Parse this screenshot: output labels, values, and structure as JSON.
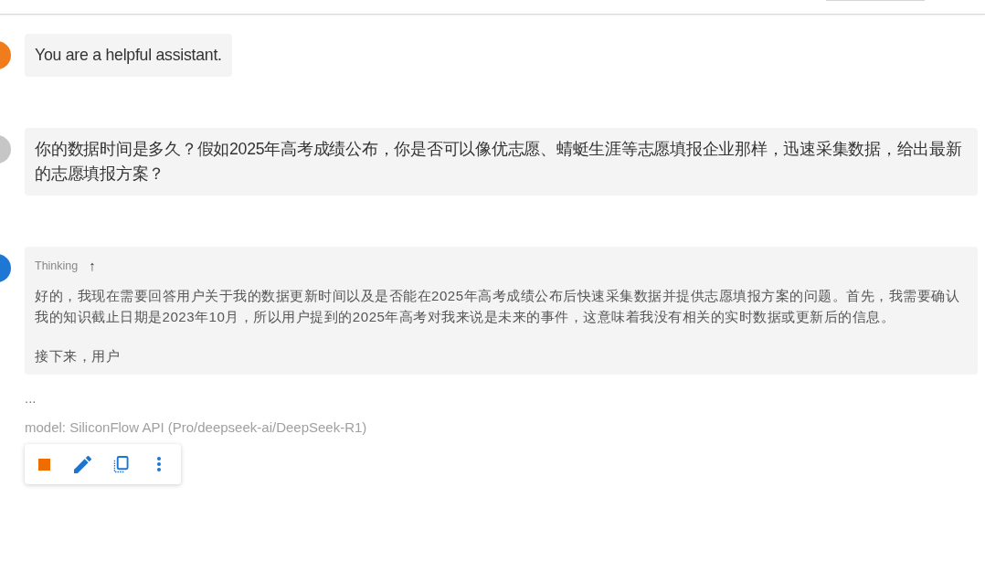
{
  "messages": [
    {
      "color": "#f07c1c",
      "text": "You are a helpful assistant."
    },
    {
      "color": "#c6c6c6",
      "text": "你的数据时间是多久？假如2025年高考成绩公布，你是否可以像优志愿、蜻蜓生涯等志愿填报企业那样，迅速采集数据，给出最新的志愿填报方案？"
    },
    {
      "color": "#1e77d3",
      "thinking": {
        "label": "Thinking",
        "toggle": "↑",
        "paragraphs": [
          "好的，我现在需要回答用户关于我的数据更新时间以及是否能在2025年高考成绩公布后快速采集数据并提供志愿填报方案的问题。首先，我需要确认我的知识截止日期是2023年10月，所以用户提到的2025年高考对我来说是未来的事件，这意味着我没有相关的实时数据或更新后的信息。",
          "接下来，用户"
        ]
      },
      "ellipsis": "...",
      "model": "model: SiliconFlow API (Pro/deepseek-ai/DeepSeek-R1)",
      "actions": [
        {
          "kind": "stop"
        },
        {
          "kind": "edit"
        },
        {
          "kind": "copy"
        },
        {
          "kind": "more"
        }
      ]
    }
  ]
}
